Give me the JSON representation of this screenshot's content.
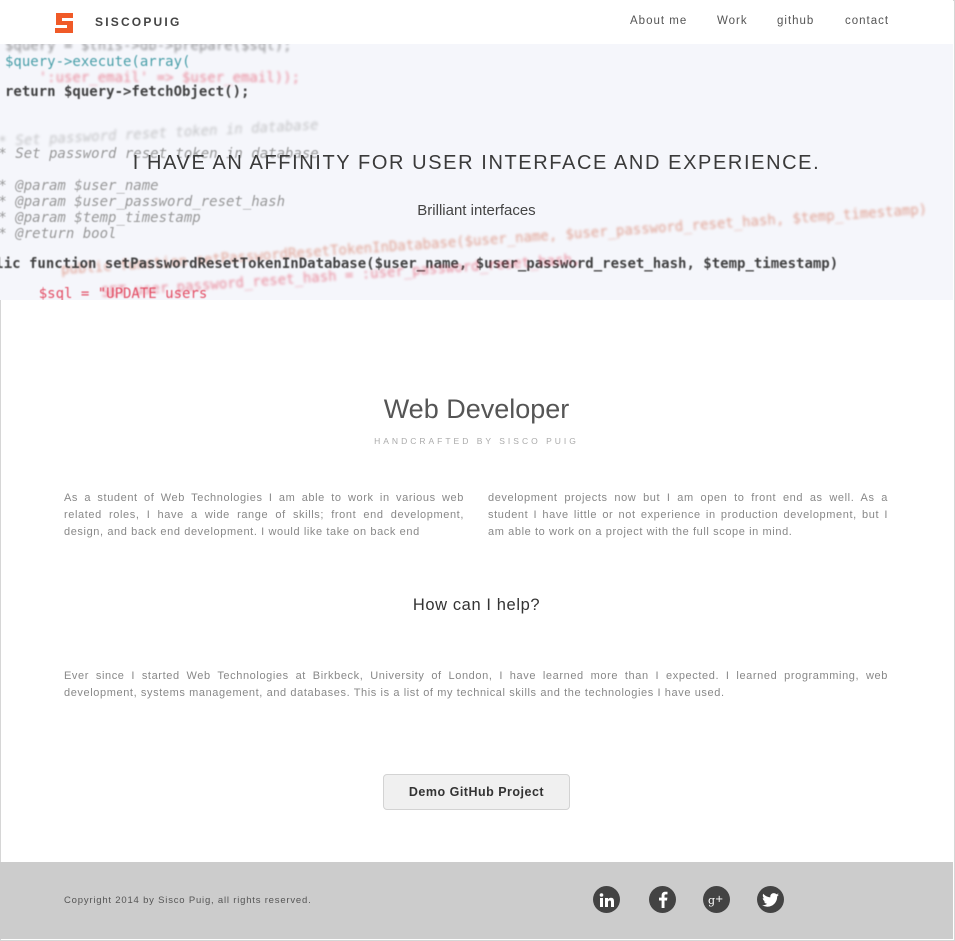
{
  "header": {
    "brand": "SISCOPUIG",
    "nav": [
      {
        "label": "About me"
      },
      {
        "label": "Work"
      },
      {
        "label": "github"
      },
      {
        "label": "contact"
      }
    ]
  },
  "hero": {
    "title": "I HAVE AN AFFINITY FOR USER INTERFACE AND EXPERIENCE.",
    "subtitle": "Brilliant interfaces",
    "code_lines": {
      "l1": "$query = $this->db->prepare($sql);",
      "l2": "$query->execute(array(",
      "l3": "    ':user_email' => $user_email));",
      "l4": "return $query->fetchObject();",
      "l5": " * Set password reset token in database",
      "l6": " * @param $user_name",
      "l7": " * @param $user_password_reset_hash",
      "l8": " * @param $temp_timestamp",
      "l9": " * @return bool",
      "l10": "public function setPasswordResetTokenInDatabase($user_name, $user_password_reset_hash, $temp_timestamp)",
      "l11": "    $sql = \"UPDATE users",
      "l12": "      SET user_password_reset_hash = :user_password_reset_hash,"
    }
  },
  "intro": {
    "title": "Web Developer",
    "subtitle": "HANDCRAFTED BY SISCO PUIG",
    "col1": "As a student of Web Technologies I am able to work in various web related roles, I have a wide range of skills; front end development, design, and back end development. I would like take on back end",
    "col2": "development projects now but I am open to front end as well. As a student I have little or not experience in production development, but I am able to work on a project with the full scope in mind."
  },
  "help": {
    "title": "How can I help?",
    "text": "Ever since I started Web Technologies at Birkbeck, University of London, I have learned more than I expected. I learned programming, web development, systems management, and databases. This is a list of my technical skills and the technologies I have used."
  },
  "demo_button": "Demo GitHub Project",
  "footer": {
    "copyright": "Copyright 2014 by Sisco Puig, all rights reserved.",
    "social": [
      {
        "icon": "linkedin-icon",
        "glyph": "in"
      },
      {
        "icon": "facebook-icon",
        "glyph": "f"
      },
      {
        "icon": "google-plus-icon",
        "glyph": "g+"
      },
      {
        "icon": "twitter-icon",
        "glyph": "bird"
      }
    ]
  },
  "colors": {
    "logo": "#f05a28",
    "hero_bg": "#f5f6fb",
    "footer_bg": "#cccccc",
    "social_bg": "#434343",
    "code_teal": "#2a8f9a",
    "code_red": "#e0314b"
  }
}
